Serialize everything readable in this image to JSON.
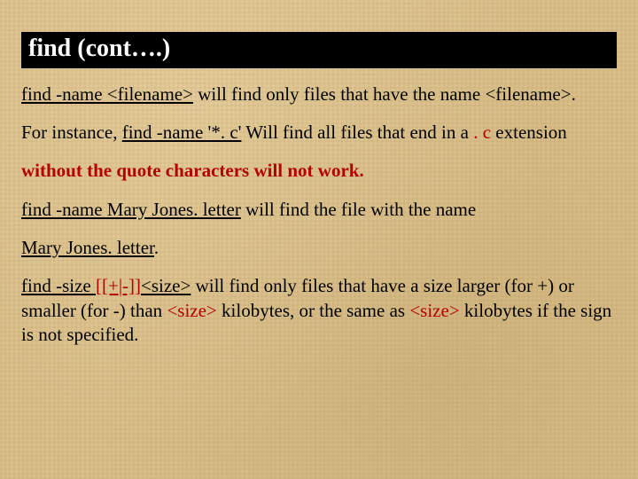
{
  "title": "find  (cont….)",
  "p1": {
    "cmd": "find -name <filename>",
    "rest": " will find only files that have the name ",
    "fname": "<filename>",
    "period": "."
  },
  "p2": {
    "a": "For instance, ",
    "cmd": "find -name '*. c'",
    "b": " Will find all files that end in a ",
    "ext": ". c",
    "c": " extension"
  },
  "p3": "without the quote characters will not work.",
  "p4": {
    "cmd": "find -name Mary Jones. letter",
    "rest": " will find the file with the name"
  },
  "p5a": "Mary Jones. letter",
  "p5b": ".",
  "p6": {
    "cmd": "find -size ",
    "flag": "[[+|-]]",
    "sz1": "<size>",
    "a": " will find only files that have a size larger (for +) or smaller (for -) than ",
    "sz2": "<size>",
    "b": " kilobytes, or the same as ",
    "sz3": "<size>",
    "c": " kilobytes if the sign is not specified."
  }
}
